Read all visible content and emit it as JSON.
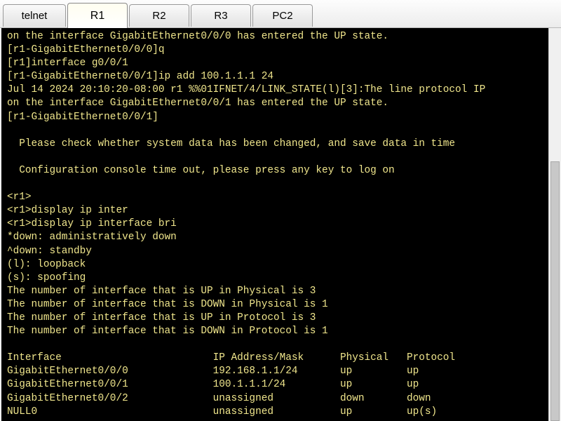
{
  "tabs": [
    {
      "label": "telnet"
    },
    {
      "label": "R1"
    },
    {
      "label": "R2"
    },
    {
      "label": "R3"
    },
    {
      "label": "PC2"
    }
  ],
  "active_tab": "R1",
  "colors": {
    "terminal_bg": "#000000",
    "terminal_fg": "#f0e68c"
  },
  "terminal": {
    "lines": [
      "on the interface GigabitEthernet0/0/0 has entered the UP state.",
      "[r1-GigabitEthernet0/0/0]q",
      "[r1]interface g0/0/1",
      "[r1-GigabitEthernet0/0/1]ip add 100.1.1.1 24",
      "Jul 14 2024 20:10:20-08:00 r1 %%01IFNET/4/LINK_STATE(l)[3]:The line protocol IP",
      "on the interface GigabitEthernet0/0/1 has entered the UP state.",
      "[r1-GigabitEthernet0/0/1]",
      "",
      "  Please check whether system data has been changed, and save data in time",
      "",
      "  Configuration console time out, please press any key to log on",
      "",
      "<r1>",
      "<r1>display ip inter",
      "<r1>display ip interface bri",
      "*down: administratively down",
      "^down: standby",
      "(l): loopback",
      "(s): spoofing",
      "The number of interface that is UP in Physical is 3",
      "The number of interface that is DOWN in Physical is 1",
      "The number of interface that is UP in Protocol is 3",
      "The number of interface that is DOWN in Protocol is 1",
      "",
      "Interface                         IP Address/Mask      Physical   Protocol",
      "GigabitEthernet0/0/0              192.168.1.1/24       up         up",
      "GigabitEthernet0/0/1              100.1.1.1/24         up         up",
      "GigabitEthernet0/0/2              unassigned           down       down",
      "NULL0                             unassigned           up         up(s)"
    ]
  }
}
